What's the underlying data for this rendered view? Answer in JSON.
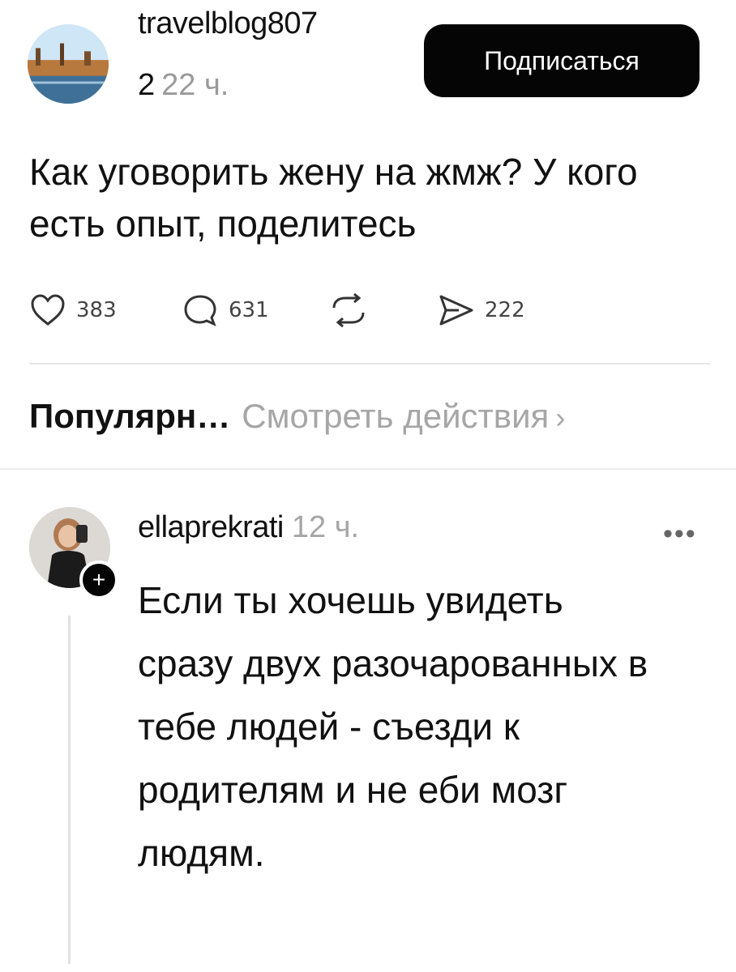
{
  "post": {
    "username": "travelblog807",
    "badge_number": "2",
    "time": "22 ч.",
    "follow_label": "Подписаться",
    "text": "Как уговорить жену на жмж? У кого есть опыт, поделитесь",
    "actions": {
      "likes": "383",
      "comments": "631",
      "shares": "222"
    }
  },
  "popular": {
    "label": "Популярн…",
    "link": "Смотреть действия"
  },
  "comment": {
    "username": "ellaprekrati",
    "time": "12 ч.",
    "text": "Если ты хочешь увидеть сразу двух разочарованных в тебе людей - съезди к родителям и не еби мозг людям."
  },
  "icons": {
    "like": "heart-icon",
    "comment": "comment-bubble-icon",
    "repost": "repost-icon",
    "share": "send-icon",
    "more": "more-dots-icon",
    "follow_plus": "plus-icon",
    "chevron": "chevron-right-icon"
  },
  "colors": {
    "button_bg": "#050505",
    "muted_text": "#9a9a9a"
  }
}
